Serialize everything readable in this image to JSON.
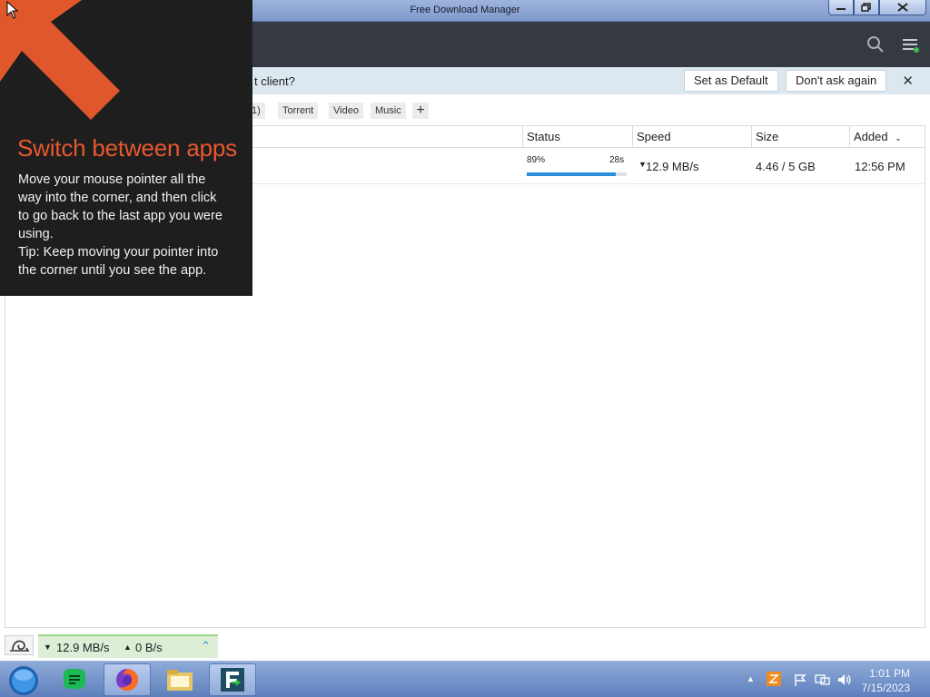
{
  "window": {
    "title": "Free Download Manager"
  },
  "infobar": {
    "question": "t client?",
    "set_default": "Set as Default",
    "dont_ask": "Don't ask again"
  },
  "filters": {
    "partial": "1)",
    "torrent": "Torrent",
    "video": "Video",
    "music": "Music"
  },
  "columns": {
    "status": "Status",
    "speed": "Speed",
    "size": "Size",
    "added": "Added"
  },
  "download": {
    "percent": "89%",
    "progress": 0.89,
    "eta": "28s",
    "speed": "12.9 MB/s",
    "size": "4.46 / 5 GB",
    "added": "12:56 PM"
  },
  "statusbar": {
    "down": "12.9 MB/s",
    "up": "0 B/s"
  },
  "tip": {
    "title": "Switch between apps",
    "line1": "Move your mouse pointer all the",
    "line2": "way into the corner, and then click",
    "line3": "to go back to the last app you were",
    "line4": "using.",
    "line5": "Tip: Keep moving your pointer into",
    "line6": "the corner until you see the app."
  },
  "taskbar": {
    "time": "1:01 PM",
    "date": "7/15/2023"
  },
  "colors": {
    "accent": "#2a8ed8",
    "tip_title": "#e8582e",
    "toolbar": "#353a42"
  }
}
